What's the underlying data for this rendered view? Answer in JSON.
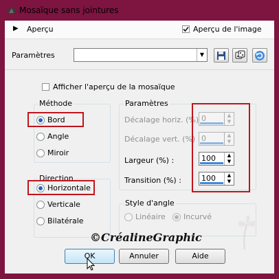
{
  "window": {
    "title": "Mosaïque sans jointures"
  },
  "header": {
    "apercu": "Aperçu",
    "apercu_image": "Aperçu de l'image"
  },
  "params_row": {
    "label": "Paramètres",
    "value": ""
  },
  "show_preview": {
    "label": "Afficher l'aperçu de la mosaïque"
  },
  "methode": {
    "title": "Méthode",
    "options": [
      {
        "label": "Bord"
      },
      {
        "label": "Angle"
      },
      {
        "label": "Miroir"
      }
    ]
  },
  "direction": {
    "title": "Direction",
    "options": [
      {
        "label": "Horizontale"
      },
      {
        "label": "Verticale"
      },
      {
        "label": "Bilatérale"
      }
    ]
  },
  "parametres": {
    "title": "Paramètres",
    "fields": [
      {
        "label": "Décalage horiz. (%) :",
        "value": "0"
      },
      {
        "label": "Décalage vert. (%) :",
        "value": "0"
      },
      {
        "label": "Largeur (%) :",
        "value": "100"
      },
      {
        "label": "Transition (%) :",
        "value": "100"
      }
    ]
  },
  "style_angle": {
    "title": "Style d'angle",
    "options": [
      {
        "label": "Linéaire"
      },
      {
        "label": "Incurvé"
      }
    ]
  },
  "watermark": "©CréalineGraphic",
  "buttons": {
    "ok": "OK",
    "cancel": "Annuler",
    "help": "Aide"
  },
  "colors": {
    "frame": "#7e1440",
    "highlight": "#c0141c",
    "accent": "#1f63c6"
  }
}
